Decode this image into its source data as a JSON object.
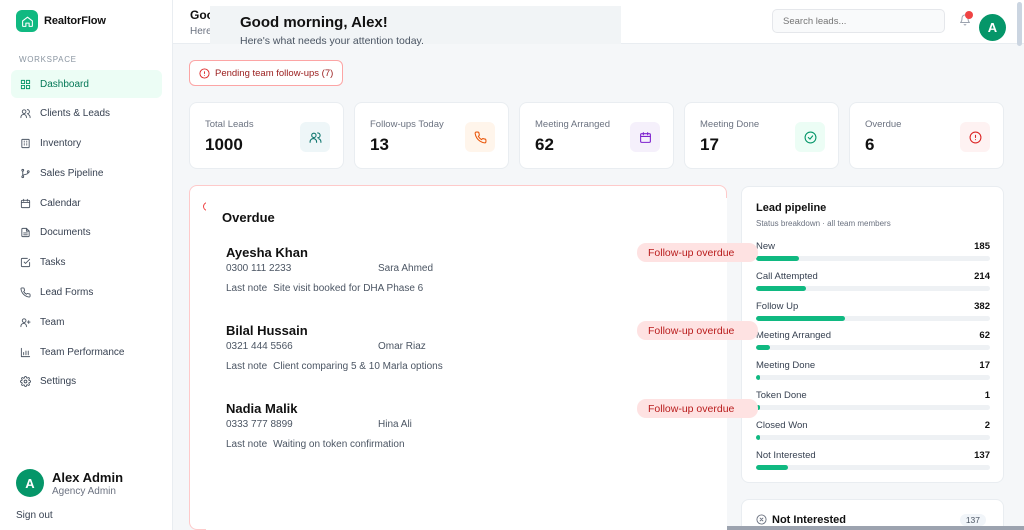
{
  "app": {
    "name": "RealtorFlow"
  },
  "sidebar": {
    "section_label": "WORKSPACE",
    "items": [
      {
        "label": "Dashboard",
        "icon": "grid-icon"
      },
      {
        "label": "Clients & Leads",
        "icon": "users-icon"
      },
      {
        "label": "Inventory",
        "icon": "building-icon"
      },
      {
        "label": "Sales Pipeline",
        "icon": "git-branch-icon"
      },
      {
        "label": "Calendar",
        "icon": "calendar-icon"
      },
      {
        "label": "Documents",
        "icon": "file-icon"
      },
      {
        "label": "Tasks",
        "icon": "checkbox-icon"
      },
      {
        "label": "Lead Forms",
        "icon": "phone-icon"
      },
      {
        "label": "Team",
        "icon": "user-plus-icon"
      },
      {
        "label": "Team Performance",
        "icon": "bar-chart-icon"
      },
      {
        "label": "Settings",
        "icon": "gear-icon"
      }
    ],
    "active_index": 0,
    "user": {
      "initial": "A",
      "name": "Alex Admin",
      "role": "Agency Admin"
    },
    "signout": "Sign out"
  },
  "header": {
    "title_partial": "Good morning, Alex!",
    "subtitle_partial": "Here's what needs your attention today.",
    "search_placeholder": "Search leads...",
    "avatar_initial": "A"
  },
  "greeting": {
    "title": "Good morning, Alex!",
    "subtitle": "Here's what needs your attention today."
  },
  "pending": {
    "label": "Pending team follow-ups (7)"
  },
  "stats": [
    {
      "label": "Total Leads",
      "value": "1000",
      "icon": "users-icon",
      "color": "#0f766e",
      "bg": "#eef6f8"
    },
    {
      "label": "Follow-ups Today",
      "value": "13",
      "icon": "phone-icon",
      "color": "#ea580c",
      "bg": "#fff5eb"
    },
    {
      "label": "Meeting Arranged",
      "value": "62",
      "icon": "calendar-icon",
      "color": "#7e22ce",
      "bg": "#f5f0fb"
    },
    {
      "label": "Meeting Done",
      "value": "17",
      "icon": "check-circle-icon",
      "color": "#059669",
      "bg": "#ecfdf5"
    },
    {
      "label": "Overdue",
      "value": "6",
      "icon": "alert-circle-icon",
      "color": "#dc2626",
      "bg": "#fef2f2"
    }
  ],
  "overdue": {
    "title": "Overdue",
    "note_label": "Last note",
    "badge": "Follow-up overdue",
    "leads": [
      {
        "name": "Ayesha Khan",
        "phone": "0300 111 2233",
        "owner": "Sara Ahmed",
        "note": "Site visit booked for DHA Phase 6"
      },
      {
        "name": "Bilal Hussain",
        "phone": "0321 444 5566",
        "owner": "Omar Riaz",
        "note": "Client comparing 5 & 10 Marla options"
      },
      {
        "name": "Nadia Malik",
        "phone": "0333 777 8899",
        "owner": "Hina Ali",
        "note": "Waiting on token confirmation"
      }
    ]
  },
  "pipeline": {
    "title": "Lead pipeline",
    "subtitle": "Status breakdown · all team members",
    "max": 382,
    "stages": [
      {
        "name": "New",
        "count": 185
      },
      {
        "name": "Call Attempted",
        "count": 214
      },
      {
        "name": "Follow Up",
        "count": 382
      },
      {
        "name": "Meeting Arranged",
        "count": 62
      },
      {
        "name": "Meeting Done",
        "count": 17
      },
      {
        "name": "Token Done",
        "count": 1
      },
      {
        "name": "Closed Won",
        "count": 2
      },
      {
        "name": "Not Interested",
        "count": 137
      }
    ]
  },
  "not_interested": {
    "label": "Not Interested",
    "count": "137"
  },
  "colors": {
    "accent": "#10b981",
    "danger": "#dc2626"
  }
}
